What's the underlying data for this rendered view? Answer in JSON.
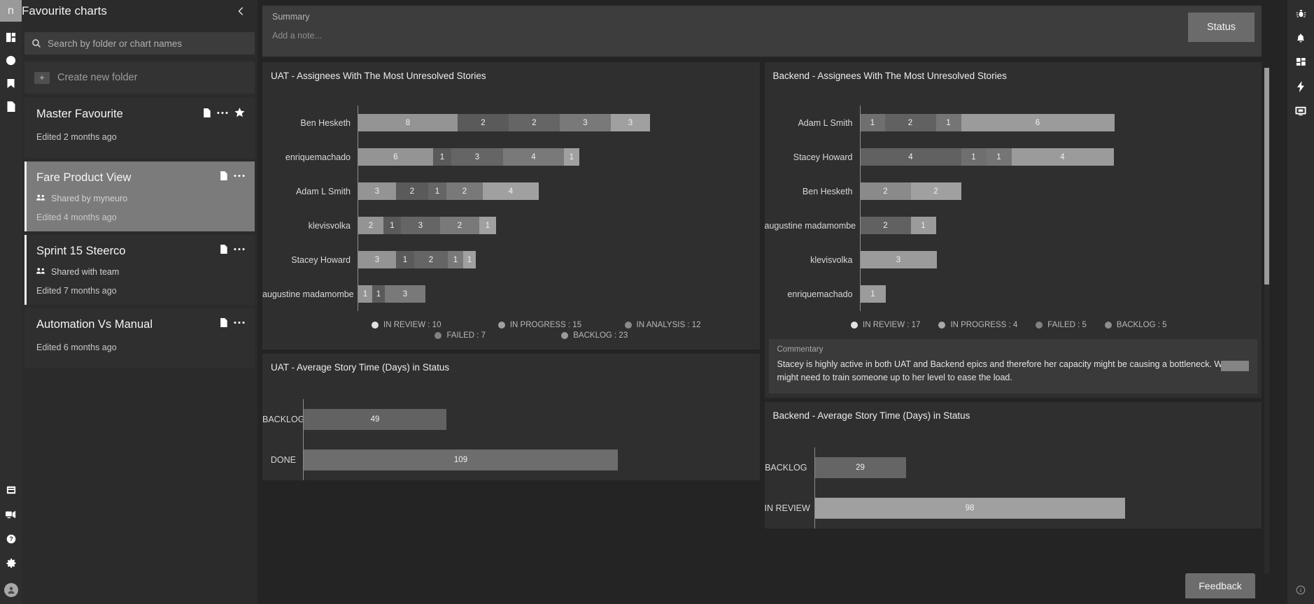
{
  "left_rail": {
    "logo_text": "n",
    "top_icons": [
      {
        "name": "dashboard-icon"
      },
      {
        "name": "compass-icon"
      },
      {
        "name": "bookmark-icon"
      },
      {
        "name": "document-icon"
      }
    ],
    "bottom_icons": [
      {
        "name": "book-icon"
      },
      {
        "name": "screen-share-icon"
      },
      {
        "name": "help-icon"
      },
      {
        "name": "gear-icon"
      },
      {
        "name": "user-avatar-icon"
      }
    ]
  },
  "sidebar": {
    "title": "Favourite charts",
    "collapse_icon": "chevron-left-icon",
    "search": {
      "placeholder": "Search by folder or chart names",
      "icon": "search-icon"
    },
    "create_folder": {
      "label": "Create new folder",
      "icon": "folder-plus-icon"
    },
    "cards": [
      {
        "title": "Master Favourite",
        "shared": null,
        "edited": "Edited 2 months ago",
        "selected": false,
        "bordered": false,
        "starred": true,
        "icons": [
          "document-icon",
          "more-icon",
          "star-icon"
        ]
      },
      {
        "title": "Fare Product View",
        "shared": "Shared by myneuro",
        "edited": "Edited 4 months ago",
        "selected": true,
        "bordered": true,
        "starred": false,
        "icons": [
          "document-icon",
          "more-icon"
        ]
      },
      {
        "title": "Sprint 15 Steerco",
        "shared": "Shared with team",
        "edited": "Edited 7 months ago",
        "selected": false,
        "bordered": true,
        "starred": false,
        "icons": [
          "document-icon",
          "more-icon"
        ]
      },
      {
        "title": "Automation Vs Manual",
        "shared": null,
        "edited": "Edited 6 months ago",
        "selected": false,
        "bordered": false,
        "starred": false,
        "icons": [
          "document-icon",
          "more-icon"
        ]
      }
    ]
  },
  "main": {
    "summary": {
      "label": "Summary",
      "note_placeholder": "Add a note...",
      "status_button": "Status"
    },
    "commentary": {
      "label": "Commentary",
      "text": "Stacey is highly active in both UAT and Backend epics and therefore her capacity might be causing a bottleneck. We might need to train someone up to her level to ease the load."
    },
    "feedback_button": "Feedback"
  },
  "right_rail": {
    "icons": [
      {
        "name": "bug-icon"
      },
      {
        "name": "bell-icon"
      },
      {
        "name": "grid-icon"
      },
      {
        "name": "bolt-icon"
      },
      {
        "name": "monitor-icon"
      }
    ],
    "bottom_icon": {
      "name": "info-icon"
    }
  },
  "chart_data": [
    {
      "id": "uat_assignees",
      "type": "bar",
      "orientation": "horizontal",
      "stacked": true,
      "title": "UAT - Assignees With The Most Unresolved Stories",
      "xlabel": "",
      "ylabel": "",
      "grid": false,
      "legend_position": "bottom",
      "categories": [
        "Ben Hesketh",
        "enriquemachado",
        "Adam L Smith",
        "klevisvolka",
        "Stacey Howard",
        "augustine madamombe"
      ],
      "segments": [
        {
          "values": [
            8,
            2,
            2,
            3,
            3
          ],
          "widths": [
            142,
            73,
            73,
            73,
            56
          ],
          "colors": [
            "#949494",
            "#5a5a5a",
            "#656565",
            "#797979",
            "#a0a0a0"
          ]
        },
        {
          "values": [
            6,
            1,
            3,
            4,
            1
          ],
          "widths": [
            107,
            26,
            74,
            87,
            22
          ],
          "colors": [
            "#949494",
            "#5a5a5a",
            "#656565",
            "#797979",
            "#a0a0a0"
          ]
        },
        {
          "values": [
            3,
            2,
            1,
            2,
            4
          ],
          "widths": [
            54,
            46,
            26,
            52,
            80
          ],
          "colors": [
            "#949494",
            "#5a5a5a",
            "#656565",
            "#797979",
            "#a0a0a0"
          ]
        },
        {
          "values": [
            2,
            1,
            3,
            2,
            1
          ],
          "widths": [
            36,
            25,
            56,
            56,
            24
          ],
          "colors": [
            "#949494",
            "#5a5a5a",
            "#656565",
            "#797979",
            "#a0a0a0"
          ]
        },
        {
          "values": [
            3,
            1,
            2,
            1,
            1
          ],
          "widths": [
            54,
            26,
            48,
            22,
            18
          ],
          "colors": [
            "#949494",
            "#5a5a5a",
            "#656565",
            "#797979",
            "#a0a0a0"
          ]
        },
        {
          "values": [
            1,
            1,
            3
          ],
          "widths": [
            20,
            18,
            58
          ],
          "colors": [
            "#949494",
            "#5a5a5a",
            "#797979"
          ]
        }
      ],
      "legend": [
        {
          "label": "IN REVIEW : 10",
          "color": "#e2e2e2"
        },
        {
          "label": "IN PROGRESS : 15",
          "color": "#a0a0a0"
        },
        {
          "label": "IN ANALYSIS : 12",
          "color": "#8a8a8a"
        },
        {
          "label": "FAILED : 7",
          "color": "#828282"
        },
        {
          "label": "BACKLOG : 23",
          "color": "#9a9a9a"
        }
      ],
      "legend_totals": {
        "IN REVIEW": 10,
        "IN PROGRESS": 15,
        "IN ANALYSIS": 12,
        "FAILED": 7,
        "BACKLOG": 23
      }
    },
    {
      "id": "backend_assignees",
      "type": "bar",
      "orientation": "horizontal",
      "stacked": true,
      "title": "Backend - Assignees With The Most Unresolved Stories",
      "xlabel": "",
      "ylabel": "",
      "grid": false,
      "legend_position": "bottom",
      "categories": [
        "Adam L Smith",
        "Stacey Howard",
        "Ben Hesketh",
        "augustine madamombe",
        "klevisvolka",
        "enriquemachado"
      ],
      "segments": [
        {
          "values": [
            1,
            2,
            1,
            6
          ],
          "widths": [
            35,
            73,
            36,
            219
          ],
          "colors": [
            "#6f6f6f",
            "#616161",
            "#757575",
            "#9b9b9b"
          ]
        },
        {
          "values": [
            4,
            1,
            1,
            4
          ],
          "widths": [
            144,
            36,
            36,
            146
          ],
          "colors": [
            "#616161",
            "#6f6f6f",
            "#757575",
            "#9b9b9b"
          ]
        },
        {
          "values": [
            2,
            2
          ],
          "widths": [
            72,
            72
          ],
          "colors": [
            "#8a8a8a",
            "#a0a0a0"
          ]
        },
        {
          "values": [
            2,
            1
          ],
          "widths": [
            72,
            36
          ],
          "colors": [
            "#616161",
            "#9b9b9b"
          ]
        },
        {
          "values": [
            3
          ],
          "widths": [
            109
          ],
          "colors": [
            "#9b9b9b"
          ]
        },
        {
          "values": [
            1
          ],
          "widths": [
            36
          ],
          "colors": [
            "#9b9b9b"
          ]
        }
      ],
      "legend": [
        {
          "label": "IN REVIEW : 17",
          "color": "#e2e2e2"
        },
        {
          "label": "IN PROGRESS : 4",
          "color": "#a9a9a9"
        },
        {
          "label": "FAILED : 5",
          "color": "#828282"
        },
        {
          "label": "BACKLOG : 5",
          "color": "#8d8d8d"
        }
      ],
      "legend_totals": {
        "IN REVIEW": 17,
        "IN PROGRESS": 4,
        "FAILED": 5,
        "BACKLOG": 5
      }
    },
    {
      "id": "uat_avg_story_time",
      "type": "bar",
      "orientation": "horizontal",
      "stacked": false,
      "title": "UAT - Average Story Time (Days) in Status",
      "xlabel": "",
      "ylabel": "",
      "grid": false,
      "categories": [
        "BACKLOG",
        "DONE"
      ],
      "values": [
        49,
        109
      ],
      "widths": [
        204,
        449
      ],
      "colors": [
        "#626262",
        "#6d6d6d"
      ],
      "xlim": [
        0,
        120
      ]
    },
    {
      "id": "backend_avg_story_time",
      "type": "bar",
      "orientation": "horizontal",
      "stacked": false,
      "title": "Backend - Average Story Time (Days) in Status",
      "xlabel": "",
      "ylabel": "",
      "grid": false,
      "categories": [
        "BACKLOG",
        "IN REVIEW"
      ],
      "values": [
        29,
        98
      ],
      "widths": [
        130,
        443
      ],
      "colors": [
        "#656565",
        "#a0a0a0"
      ],
      "xlim": [
        0,
        110
      ]
    }
  ]
}
